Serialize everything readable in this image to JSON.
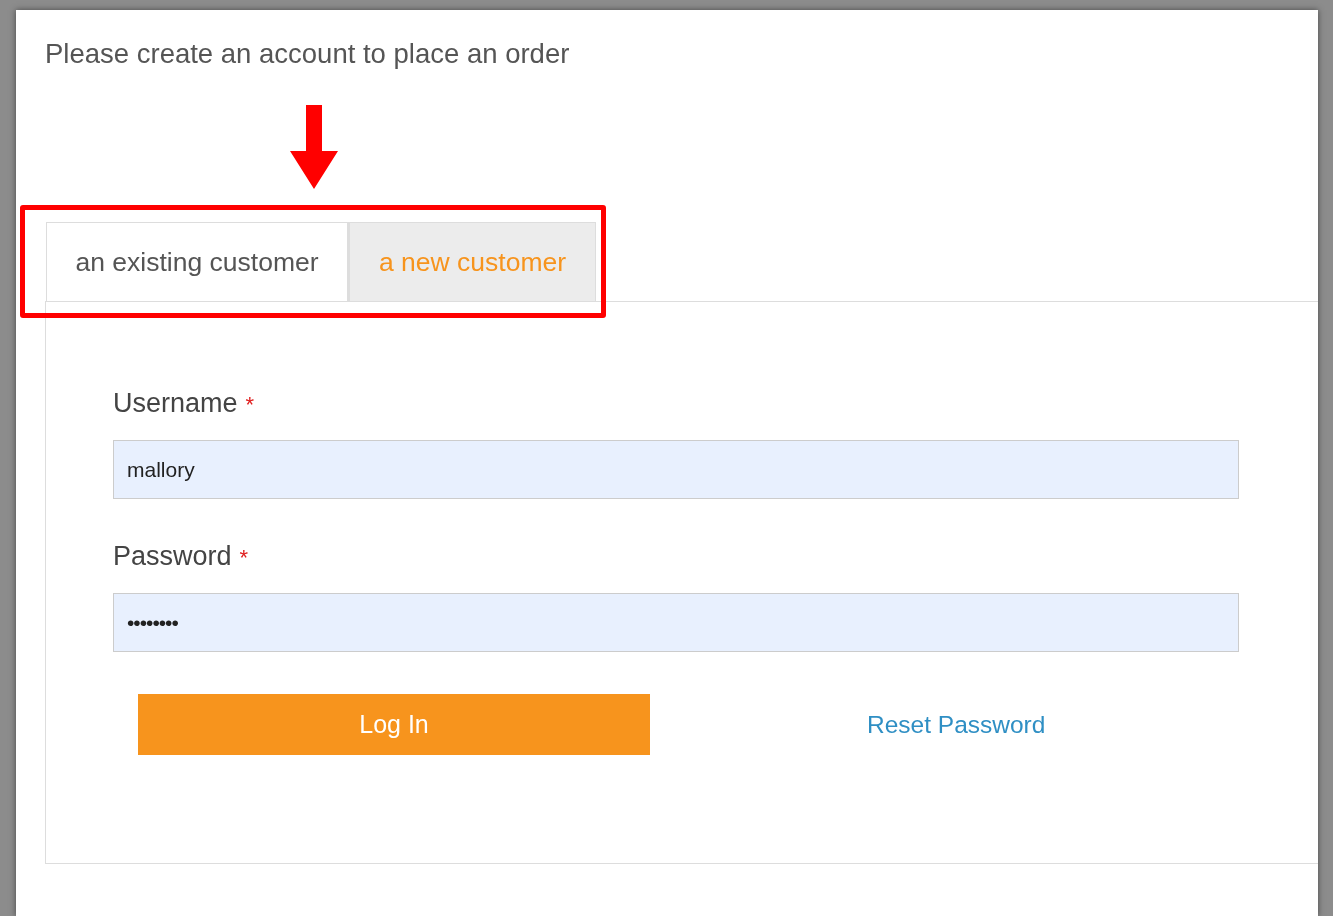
{
  "heading": "Please create an account to place an order",
  "tabs": [
    {
      "label": "an existing customer",
      "selected": true
    },
    {
      "label": "a new customer",
      "selected": false
    }
  ],
  "fields": [
    {
      "label": "Username",
      "required_mark": "*",
      "value": "mallory"
    },
    {
      "label": "Password",
      "required_mark": "*",
      "value": "••••••••"
    }
  ],
  "login_button": "Log In",
  "reset_link": "Reset Password",
  "annotation_arrow": true,
  "annotation_frame": true
}
